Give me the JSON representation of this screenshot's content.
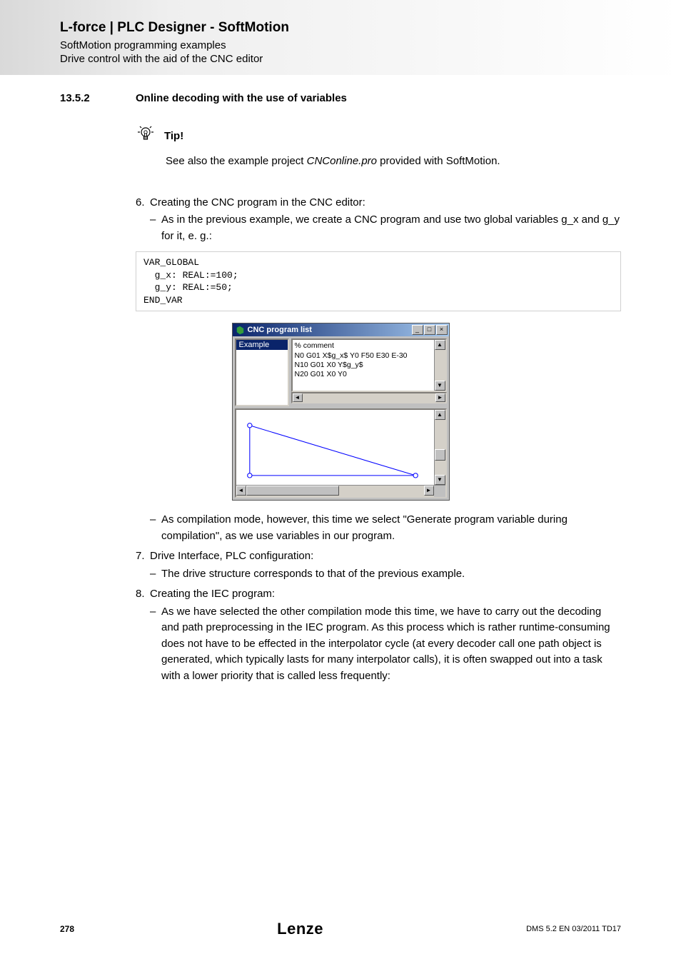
{
  "header": {
    "title": "L-force | PLC Designer - SoftMotion",
    "sub1": "SoftMotion programming examples",
    "sub2": "Drive control with the aid of the CNC editor"
  },
  "section": {
    "number": "13.5.2",
    "title": "Online decoding with the use of variables"
  },
  "tip": {
    "label": "Tip!",
    "before": "See also the example project ",
    "italic": "CNConline.pro",
    "after": " provided with SoftMotion."
  },
  "step6": {
    "num": "6.",
    "text": "Creating the CNC program in the CNC editor:",
    "bullet1": "As in the previous example, we create a CNC program and use two global variables g_x and g_y for it, e. g.:"
  },
  "code": "VAR_GLOBAL\n  g_x: REAL:=100;\n  g_y: REAL:=50;\nEND_VAR",
  "shot": {
    "title": "CNC program list",
    "listitem": "Example",
    "line1": "% comment",
    "line2": "N0 G01 X$g_x$ Y0 F50 E30 E-30",
    "line3": "N10 G01 X0 Y$g_y$",
    "line4": "N20 G01 X0 Y0"
  },
  "step6b": "As compilation mode, however, this time we select \"Generate program variable during compilation\", as we use variables in our program.",
  "step7": {
    "num": "7.",
    "text": "Drive Interface, PLC configuration:",
    "bullet": "The drive structure corresponds to that of the previous example."
  },
  "step8": {
    "num": "8.",
    "text": "Creating the IEC program:",
    "bullet": "As we have selected the other compilation mode this time, we have to carry out the decoding and path preprocessing in the IEC program. As this process which is rather runtime-consuming does not have to be effected in the interpolator cycle (at every decoder call one path object is generated, which typically lasts for many interpolator calls), it is often swapped out into a task with a lower priority that is called less frequently:"
  },
  "footer": {
    "page": "278",
    "logo": "Lenze",
    "meta": "DMS 5.2 EN 03/2011 TD17"
  }
}
